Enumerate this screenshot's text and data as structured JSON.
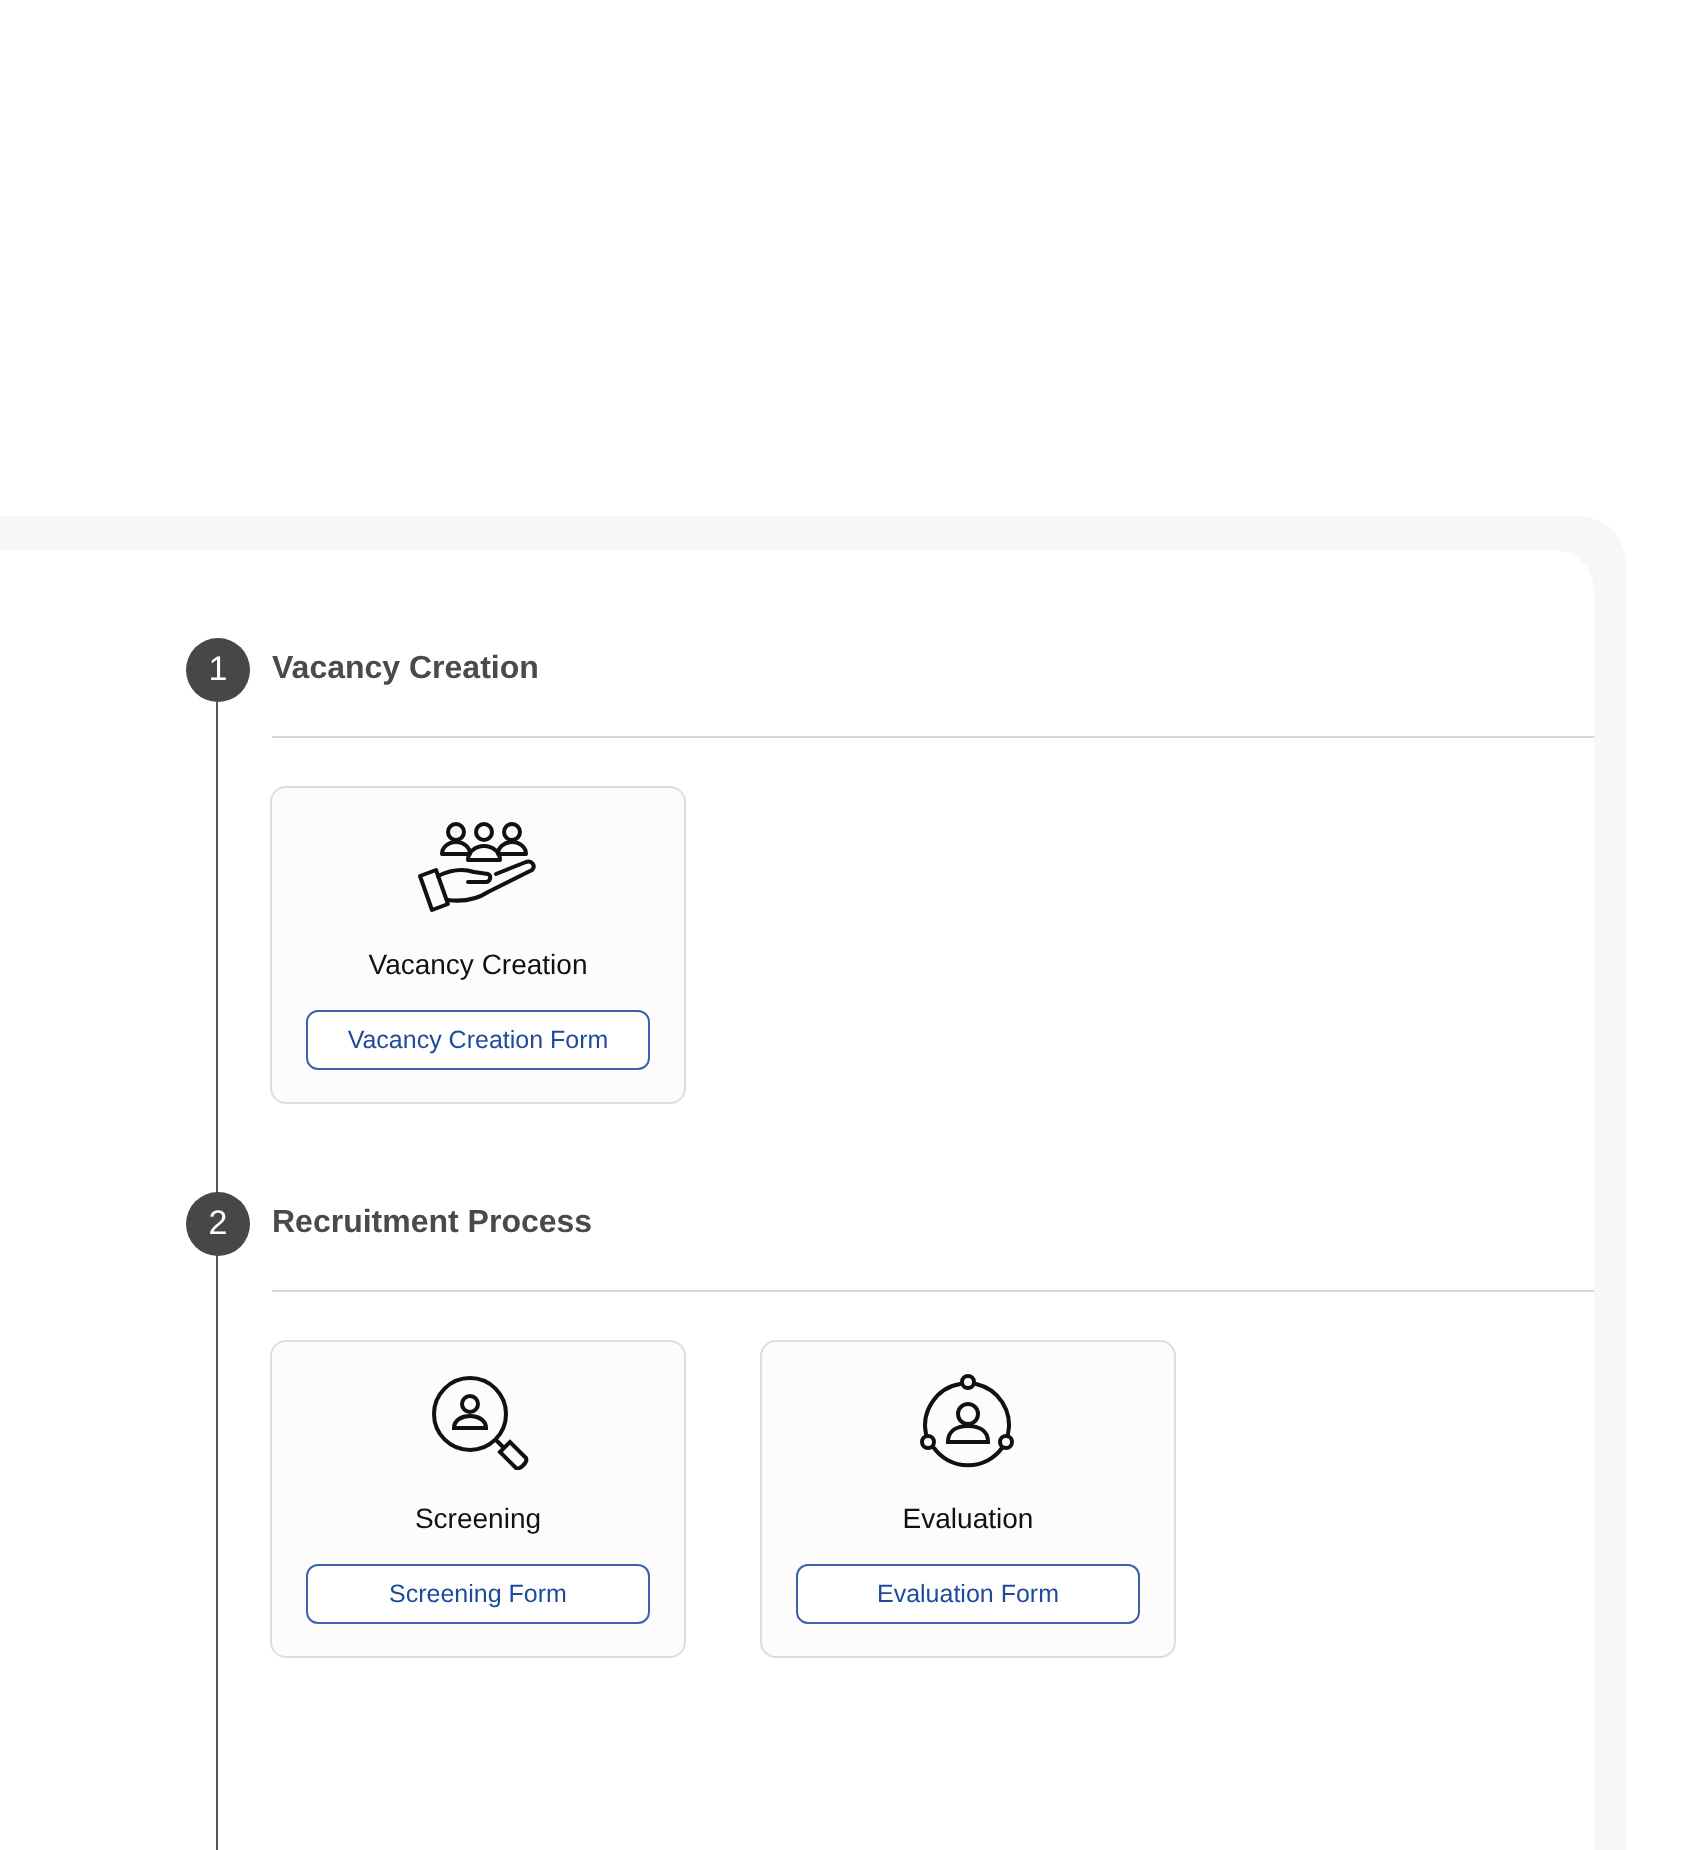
{
  "steps": [
    {
      "number": "1",
      "title": "Vacancy Creation",
      "cards": [
        {
          "kind": "hand",
          "title": "Vacancy Creation",
          "button": "Vacancy Creation Form"
        }
      ]
    },
    {
      "number": "2",
      "title": "Recruitment Process",
      "cards": [
        {
          "kind": "search",
          "title": "Screening",
          "button": "Screening Form"
        },
        {
          "kind": "cycle",
          "title": "Evaluation",
          "button": "Evaluation Form"
        }
      ]
    }
  ]
}
